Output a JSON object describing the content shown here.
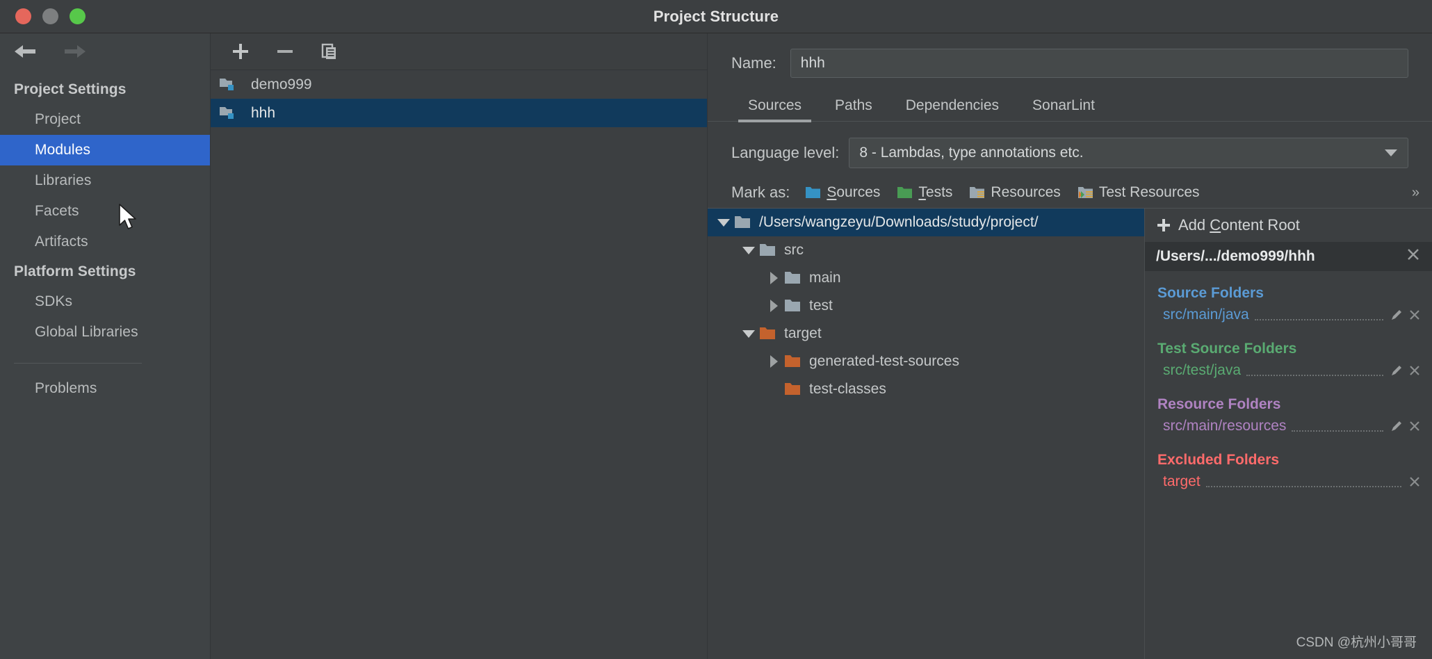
{
  "window": {
    "title": "Project Structure",
    "traffic_lights": [
      "close-red",
      "minimize-yellow",
      "zoom-green"
    ]
  },
  "sidebar": {
    "back_icon": "arrow-left-icon",
    "forward_icon": "arrow-right-icon",
    "groups": [
      {
        "label": "Project Settings",
        "items": [
          {
            "label": "Project",
            "selected": false
          },
          {
            "label": "Modules",
            "selected": true
          },
          {
            "label": "Libraries",
            "selected": false
          },
          {
            "label": "Facets",
            "selected": false
          },
          {
            "label": "Artifacts",
            "selected": false
          }
        ]
      },
      {
        "label": "Platform Settings",
        "items": [
          {
            "label": "SDKs",
            "selected": false
          },
          {
            "label": "Global Libraries",
            "selected": false
          }
        ]
      }
    ],
    "problems": "Problems"
  },
  "modules_pane": {
    "toolbar": {
      "add_icon": "plus-icon",
      "remove_icon": "minus-icon",
      "copy_icon": "copy-icon"
    },
    "modules": [
      {
        "name": "demo999",
        "selected": false
      },
      {
        "name": "hhh",
        "selected": true
      }
    ]
  },
  "detail": {
    "name_label": "Name:",
    "name_value": "hhh",
    "tabs": [
      {
        "label": "Sources",
        "active": true
      },
      {
        "label": "Paths",
        "active": false
      },
      {
        "label": "Dependencies",
        "active": false
      },
      {
        "label": "SonarLint",
        "active": false
      }
    ],
    "language_level_label": "Language level:",
    "language_level_value": "8 - Lambdas, type annotations etc.",
    "mark_as_label": "Mark as:",
    "mark_as_buttons": [
      {
        "label": "Sources",
        "mnemonic": "S",
        "rest": "ources",
        "color": "#3592c4",
        "icon": "folder-sources-icon"
      },
      {
        "label": "Tests",
        "mnemonic": "T",
        "rest": "ests",
        "color": "#499c54",
        "icon": "folder-tests-icon"
      },
      {
        "label": "Resources",
        "mnemonic": "",
        "rest": "Resources",
        "color": "#9aa7b0",
        "icon": "folder-resources-icon"
      },
      {
        "label": "Test Resources",
        "mnemonic": "",
        "rest": "Test Resources",
        "color": "#9aa7b0",
        "icon": "folder-test-resources-icon"
      }
    ],
    "mark_as_overflow": "»",
    "highlight_color": "#58d651"
  },
  "tree": [
    {
      "label": "/Users/wangzeyu/Downloads/study/project/",
      "depth": 0,
      "twisty": "down",
      "folder": "grey",
      "selected": true
    },
    {
      "label": "src",
      "depth": 1,
      "twisty": "down",
      "folder": "grey",
      "selected": false
    },
    {
      "label": "main",
      "depth": 2,
      "twisty": "right",
      "folder": "grey",
      "selected": false
    },
    {
      "label": "test",
      "depth": 2,
      "twisty": "right",
      "folder": "grey",
      "selected": false
    },
    {
      "label": "target",
      "depth": 1,
      "twisty": "down",
      "folder": "orange",
      "selected": false
    },
    {
      "label": "generated-test-sources",
      "depth": 2,
      "twisty": "right",
      "folder": "orange",
      "selected": false
    },
    {
      "label": "test-classes",
      "depth": 2,
      "twisty": "none",
      "folder": "orange",
      "selected": false
    }
  ],
  "roots": {
    "add_label": "Add Content Root",
    "add_mnemonic": "C",
    "add_prefix": "Add ",
    "add_suffix": "ontent Root",
    "add_icon": "plus-icon",
    "root_path": "/Users/.../demo999/hhh",
    "root_close_icon": "close-icon",
    "groups": [
      {
        "title": "Source Folders",
        "kind": "src",
        "color": "#5b9bd5",
        "paths": [
          {
            "path": "src/main/java",
            "has_edit": true,
            "has_remove": true
          }
        ]
      },
      {
        "title": "Test Source Folders",
        "kind": "test",
        "color": "#5aab72",
        "paths": [
          {
            "path": "src/test/java",
            "has_edit": true,
            "has_remove": true
          }
        ]
      },
      {
        "title": "Resource Folders",
        "kind": "res",
        "color": "#b083c2",
        "paths": [
          {
            "path": "src/main/resources",
            "has_edit": true,
            "has_remove": true
          }
        ]
      },
      {
        "title": "Excluded Folders",
        "kind": "exc",
        "color": "#ff6b6b",
        "paths": [
          {
            "path": "target",
            "has_edit": false,
            "has_remove": true
          }
        ]
      }
    ]
  },
  "watermark": "CSDN @杭州小哥哥"
}
